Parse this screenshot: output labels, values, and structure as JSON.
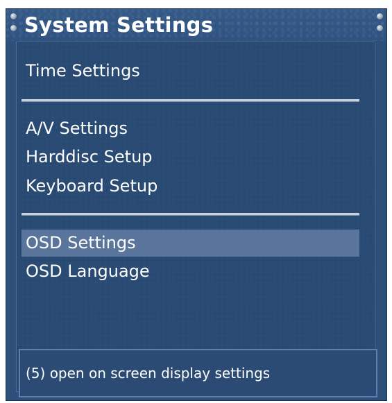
{
  "window": {
    "title": "System Settings"
  },
  "menu": {
    "groups": [
      {
        "items": [
          {
            "label": "Time Settings"
          }
        ]
      },
      {
        "items": [
          {
            "label": "A/V Settings"
          },
          {
            "label": "Harddisc Setup"
          },
          {
            "label": "Keyboard Setup"
          }
        ]
      },
      {
        "items": [
          {
            "label": "OSD Settings",
            "selected": true
          },
          {
            "label": "OSD Language"
          }
        ]
      }
    ]
  },
  "status": {
    "text": "(5) open on screen display settings"
  },
  "colors": {
    "background": "#2d4f7a",
    "selection": "#5a759c",
    "divider": "#c9d2dc",
    "text": "#ffffff"
  }
}
